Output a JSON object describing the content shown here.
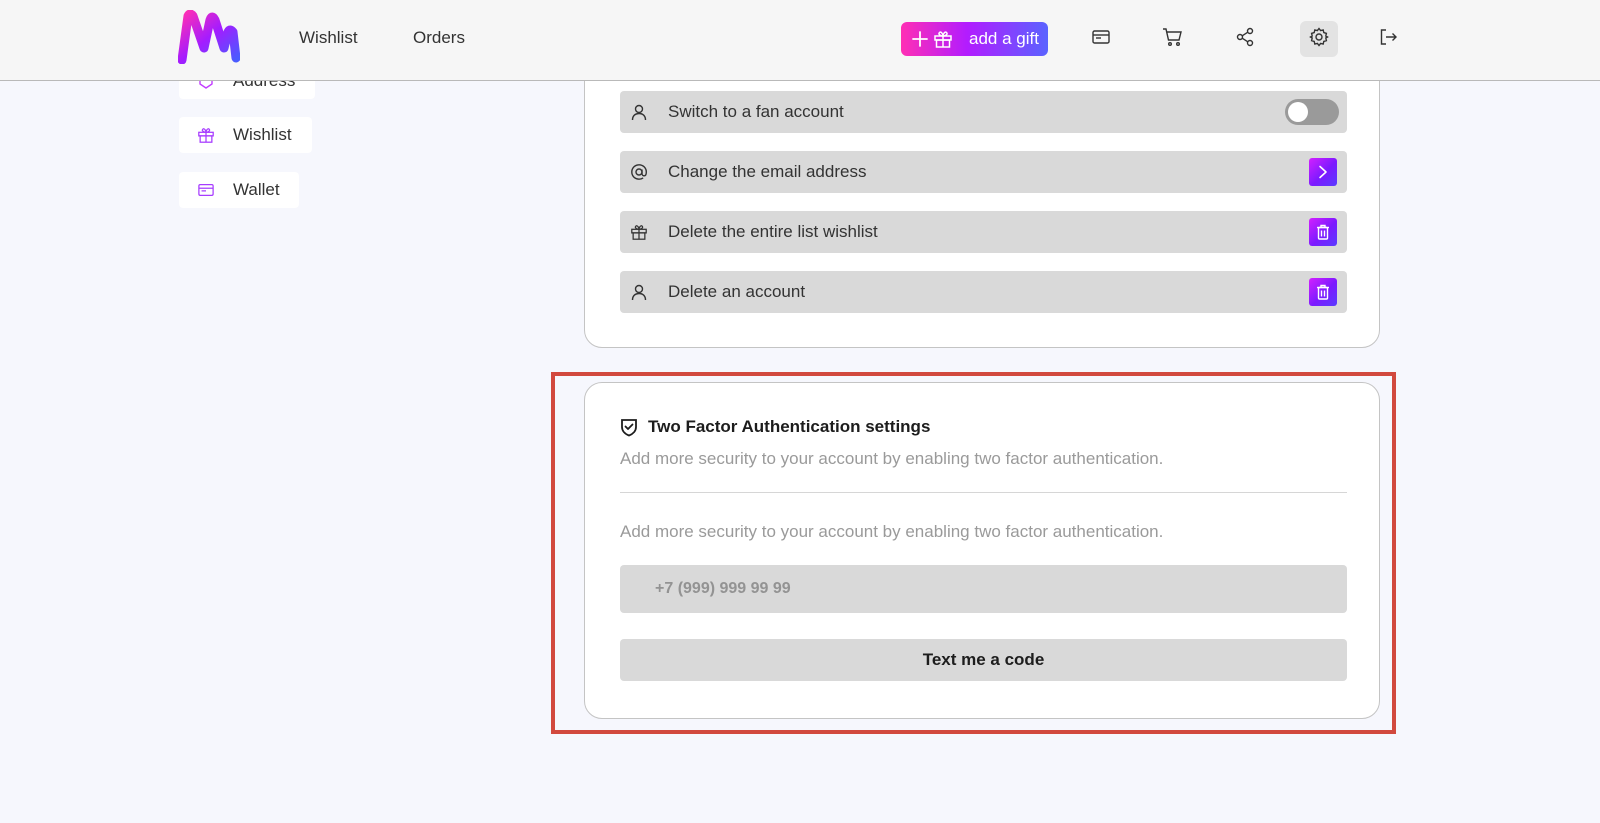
{
  "header": {
    "nav": [
      {
        "label": "Wishlist"
      },
      {
        "label": "Orders"
      }
    ],
    "add_gift_label": "add a gift",
    "icons": [
      "wallet-icon",
      "cart-icon",
      "share-icon",
      "gear-icon",
      "logout-icon"
    ]
  },
  "sidebar": {
    "items": [
      {
        "label": "Address",
        "icon": "address-icon"
      },
      {
        "label": "Wishlist",
        "icon": "gift-icon"
      },
      {
        "label": "Wallet",
        "icon": "wallet-icon"
      }
    ]
  },
  "account_settings": {
    "rows": [
      {
        "label": "Switch to a fan account",
        "icon": "user-icon",
        "control": "toggle",
        "enabled": false
      },
      {
        "label": "Change the email address",
        "icon": "at-icon",
        "control": "chevron-right-icon"
      },
      {
        "label": "Delete the entire list wishlist",
        "icon": "gift-icon",
        "control": "trash-icon"
      },
      {
        "label": "Delete an account",
        "icon": "user-icon",
        "control": "trash-icon"
      }
    ]
  },
  "two_factor": {
    "title": "Two Factor Authentication settings",
    "description": "Add more security to your account by enabling two factor authentication.",
    "description_2": "Add more security to your account by enabling two factor authentication.",
    "phone_placeholder": "+7 (999) 999 99 99",
    "button_label": "Text me a code"
  },
  "colors": {
    "accent_start": "#d320ff",
    "accent_end": "#5a63ff",
    "highlight": "#d2493e"
  }
}
